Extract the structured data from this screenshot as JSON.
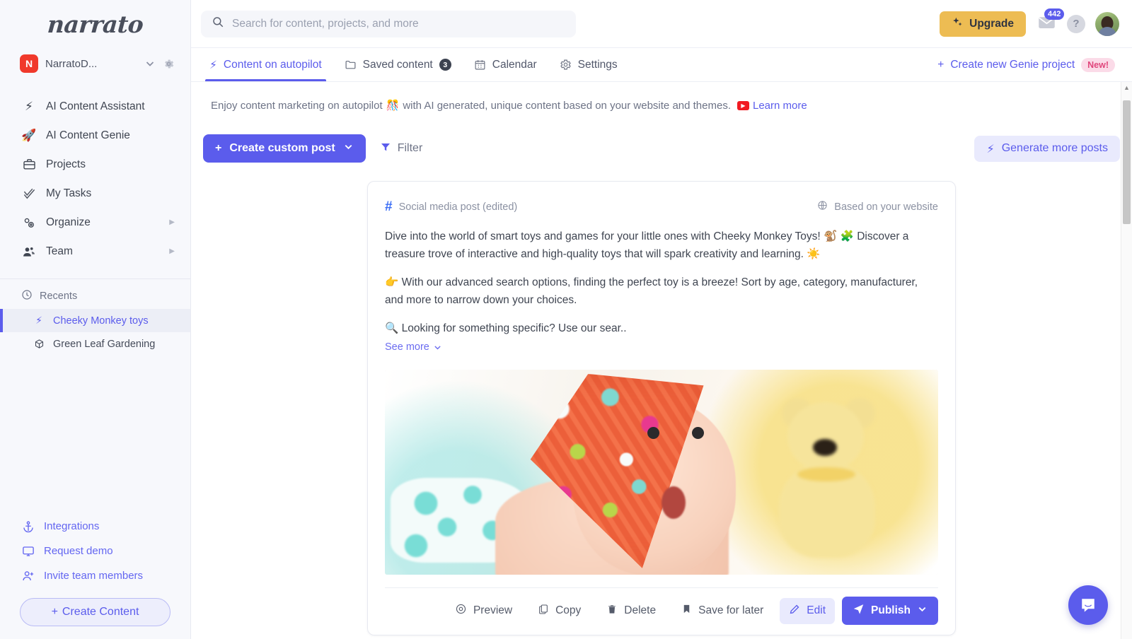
{
  "sidebar": {
    "logo": "narrato",
    "workspace": {
      "initial": "N",
      "name": "NarratoD...",
      "chevron_icon": "chevron-down-icon",
      "gear_icon": "gear-icon"
    },
    "nav": [
      {
        "label": "AI Content Assistant",
        "icon": "lightning-icon",
        "glyph": "⚡",
        "arrow": ""
      },
      {
        "label": "AI Content Genie",
        "icon": "rocket-icon",
        "glyph": "🚀",
        "arrow": ""
      },
      {
        "label": "Projects",
        "icon": "briefcase-icon",
        "glyph": "💼",
        "arrow": ""
      },
      {
        "label": "My Tasks",
        "icon": "check-icon",
        "glyph": "✓",
        "arrow": ""
      },
      {
        "label": "Organize",
        "icon": "gears-icon",
        "glyph": "⚙",
        "arrow": "▶"
      },
      {
        "label": "Team",
        "icon": "people-icon",
        "glyph": "👥",
        "arrow": "▶"
      }
    ],
    "recents": {
      "header": "Recents",
      "header_icon": "clock-icon",
      "items": [
        {
          "label": "Cheeky Monkey toys",
          "icon": "lightning-icon",
          "glyph": "⚡",
          "active": true
        },
        {
          "label": "Green Leaf Gardening",
          "icon": "cube-icon",
          "glyph": "⬡",
          "active": false
        }
      ]
    },
    "bottom_links": [
      {
        "label": "Integrations",
        "icon": "anchor-icon"
      },
      {
        "label": "Request demo",
        "icon": "monitor-icon"
      },
      {
        "label": "Invite team members",
        "icon": "user-plus-icon"
      }
    ],
    "create_content_button": "Create Content"
  },
  "topbar": {
    "search_placeholder": "Search for content, projects, and more",
    "search_value": "",
    "search_icon": "search-icon",
    "upgrade_label": "Upgrade",
    "upgrade_icon": "sparkles-icon",
    "upgrade_color": "#edbc53",
    "mail_icon": "mail-icon",
    "mail_badge": "442",
    "help_label": "?",
    "avatar": "user-avatar"
  },
  "tabs": [
    {
      "label": "Content on autopilot",
      "icon": "lightning-icon",
      "glyph": "⚡",
      "active": true,
      "badge": ""
    },
    {
      "label": "Saved content",
      "icon": "folder-icon",
      "glyph": "◻",
      "active": false,
      "badge": "3"
    },
    {
      "label": "Calendar",
      "icon": "calendar-icon",
      "glyph": "▦",
      "active": false,
      "badge": ""
    },
    {
      "label": "Settings",
      "icon": "gear-icon",
      "glyph": "⚙",
      "active": false,
      "badge": ""
    }
  ],
  "genie": {
    "label": "Create new Genie project",
    "plus": "+",
    "badge": "New!"
  },
  "banner": {
    "text_before": "Enjoy content marketing on autopilot",
    "emoji": "🎊",
    "text_after": "with AI generated, unique content based on your website and themes.",
    "youtube_icon": "youtube-icon",
    "link": "Learn more"
  },
  "toolbar": {
    "create_post_label": "Create custom post",
    "create_post_plus": "+",
    "create_post_chevron": "chevron-down-icon",
    "filter_label": "Filter",
    "filter_icon": "funnel-icon",
    "generate_label": "Generate more posts",
    "generate_icon": "lightning-icon",
    "accent_color": "#5b5cec"
  },
  "post": {
    "type_label": "Social media post (edited)",
    "type_icon": "hash-icon",
    "source_label": "Based on your website",
    "source_icon": "globe-icon",
    "paragraphs": [
      "Dive into the world of smart toys and games for your little ones with Cheeky Monkey Toys! 🐒 🧩 Discover a treasure trove of interactive and high-quality toys that will spark creativity and learning. ☀️",
      "👉 With our advanced search options, finding the perfect toy is a breeze! Sort by age, category, manufacturer, and more to narrow down your choices.",
      "🔍 Looking for something specific? Use our sear.."
    ],
    "see_more": "See more",
    "see_more_chevron": "chevron-down-icon",
    "image_alt": "baby-with-bandana-and-teddy-bear",
    "actions": [
      {
        "label": "Preview",
        "icon": "eye-icon"
      },
      {
        "label": "Copy",
        "icon": "copy-icon"
      },
      {
        "label": "Delete",
        "icon": "trash-icon"
      },
      {
        "label": "Save for later",
        "icon": "bookmark-icon"
      },
      {
        "label": "Edit",
        "icon": "pencil-icon"
      },
      {
        "label": "Publish",
        "icon": "send-icon"
      }
    ]
  },
  "chat": {
    "icon": "chat-bubble-icon"
  },
  "scrollbar": {
    "up_arrow": "▲"
  }
}
